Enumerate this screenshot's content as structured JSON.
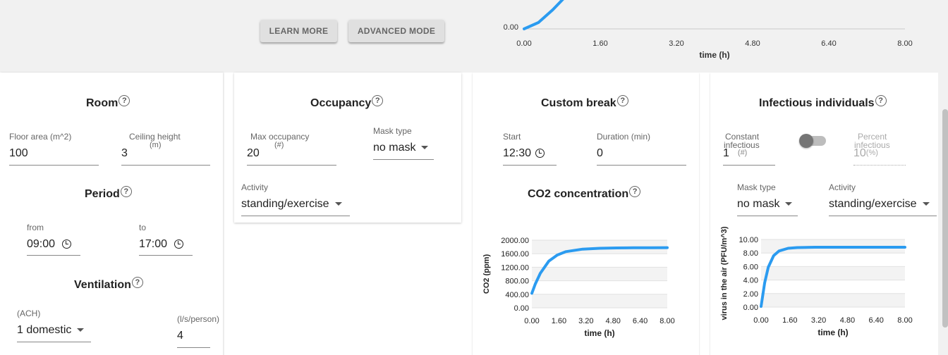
{
  "top": {
    "learn_more": "LEARN MORE",
    "advanced_mode": "ADVANCED MODE",
    "chart_y_tick": "0.00",
    "chart_x_label": "time (h)"
  },
  "room": {
    "title": "Room",
    "floor_area_label": "Floor area (m^2)",
    "floor_area_value": "100",
    "ceiling_height_label": "Ceiling height",
    "ceiling_height_unit": "(m)",
    "ceiling_height_value": "3"
  },
  "period": {
    "title": "Period",
    "from_label": "from",
    "from_value": "09:00",
    "to_label": "to",
    "to_value": "17:00"
  },
  "ventilation": {
    "title": "Ventilation",
    "ach_label": "(ACH)",
    "ach_value": "1 domestic",
    "per_person_label": "(l/s/person)",
    "per_person_value": "4"
  },
  "occupancy": {
    "title": "Occupancy",
    "max_label": "Max occupancy",
    "max_unit": "(#)",
    "max_value": "20",
    "mask_label": "Mask type",
    "mask_value": "no mask",
    "activity_label": "Activity",
    "activity_value": "standing/exercise"
  },
  "custom_break": {
    "title": "Custom break",
    "start_label": "Start",
    "start_value": "12:30",
    "duration_label": "Duration (min)",
    "duration_value": "0"
  },
  "co2": {
    "title": "CO2 concentration"
  },
  "infectious": {
    "title": "Infectious individuals",
    "constant_label_1": "Constant",
    "constant_label_2": "infectious",
    "constant_value": "1",
    "constant_unit": "(#)",
    "percent_label_1": "Percent",
    "percent_label_2": "infectious",
    "percent_value": "10",
    "percent_unit": "(%)",
    "mask_label": "Mask type",
    "mask_value": "no mask",
    "activity_label": "Activity",
    "activity_value": "standing/exercise"
  },
  "chart_data": [
    {
      "type": "line",
      "title": "",
      "xlabel": "time (h)",
      "ylabel": "",
      "x_ticks": [
        "0.00",
        "1.60",
        "3.20",
        "4.80",
        "6.40",
        "8.00"
      ],
      "xlim": [
        0,
        8
      ],
      "series": [
        {
          "x": [
            0,
            0.3,
            0.6,
            0.9
          ],
          "y": [
            0,
            0.3,
            0.9,
            1.6
          ]
        }
      ]
    },
    {
      "type": "line",
      "title": "CO2 concentration",
      "xlabel": "time (h)",
      "ylabel": "CO2 (ppm)",
      "x_ticks": [
        "0.00",
        "1.60",
        "3.20",
        "4.80",
        "6.40",
        "8.00"
      ],
      "y_ticks": [
        "0.00",
        "400.00",
        "800.00",
        "1200.00",
        "1600.00",
        "2000.00"
      ],
      "xlim": [
        0,
        8
      ],
      "ylim": [
        0,
        2000
      ],
      "series": [
        {
          "x": [
            0,
            0.2,
            0.5,
            1.0,
            1.5,
            2.0,
            3.0,
            4.0,
            5.0,
            6.0,
            7.0,
            8.0
          ],
          "y": [
            430,
            700,
            1020,
            1380,
            1560,
            1660,
            1735,
            1760,
            1770,
            1775,
            1778,
            1780
          ]
        }
      ]
    },
    {
      "type": "line",
      "title": "",
      "xlabel": "time (h)",
      "ylabel": "virus in the air (PFU/m^3)",
      "x_ticks": [
        "0.00",
        "1.60",
        "3.20",
        "4.80",
        "6.40",
        "8.00"
      ],
      "y_ticks": [
        "0.00",
        "2.00",
        "4.00",
        "6.00",
        "8.00",
        "10.00"
      ],
      "xlim": [
        0,
        8
      ],
      "ylim": [
        0,
        10
      ],
      "series": [
        {
          "x": [
            0,
            0.2,
            0.4,
            0.7,
            1.0,
            1.5,
            2.0,
            3.0,
            4.0,
            6.0,
            8.0
          ],
          "y": [
            0.1,
            3.6,
            5.9,
            7.6,
            8.3,
            8.7,
            8.8,
            8.85,
            8.85,
            8.85,
            8.85
          ]
        }
      ]
    }
  ]
}
